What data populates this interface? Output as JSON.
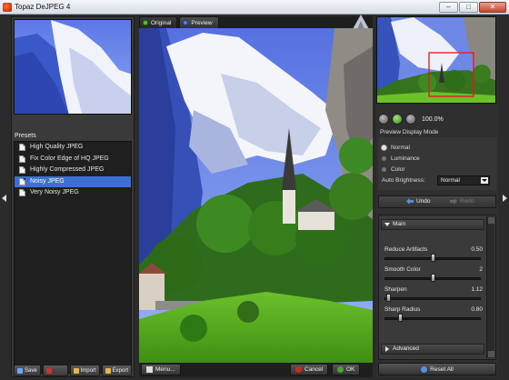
{
  "window": {
    "title": "Topaz DeJPEG 4",
    "controls": {
      "minimize": "–",
      "maximize": "□",
      "close": "✕"
    }
  },
  "presets": {
    "title": "Presets",
    "items": [
      {
        "label": "High Quality JPEG",
        "selected": false
      },
      {
        "label": "Fix Color Edge of HQ JPEG",
        "selected": false
      },
      {
        "label": "Highly Compressed JPEG",
        "selected": false
      },
      {
        "label": "Noisy JPEG",
        "selected": true
      },
      {
        "label": "Very Noisy JPEG",
        "selected": false
      }
    ]
  },
  "left_buttons": {
    "save": "Save",
    "delete": "",
    "import": "Import",
    "export": "Export"
  },
  "view_tabs": {
    "original": "Original",
    "preview": "Preview"
  },
  "center_buttons": {
    "menu": "Menu...",
    "cancel": "Cancel",
    "ok": "OK"
  },
  "zoom": {
    "level": "100.0%"
  },
  "preview_display": {
    "title": "Preview Display Mode",
    "modes": [
      {
        "label": "Normal",
        "selected": true
      },
      {
        "label": "Luminance",
        "selected": false
      },
      {
        "label": "Color",
        "selected": false
      }
    ],
    "auto_brightness_label": "Auto Brightness:",
    "auto_brightness_value": "Normal"
  },
  "history": {
    "undo": "Undo",
    "redo": "Redo"
  },
  "main_section": {
    "title": "Main",
    "sliders": [
      {
        "label": "Reduce Artifacts",
        "value": "0.50",
        "fraction": 0.5
      },
      {
        "label": "Smooth Color",
        "value": "2",
        "fraction": 0.5
      },
      {
        "label": "Sharpen",
        "value": "1.12",
        "fraction": 0.02
      },
      {
        "label": "Sharp Radius",
        "value": "0.80",
        "fraction": 0.15
      }
    ]
  },
  "advanced_section": {
    "title": "Advanced"
  },
  "reset": {
    "label": "Reset All"
  },
  "colors": {
    "accent_select": "#3c6fd4",
    "ok_green": "#4aa82e",
    "cancel_red": "#cc2b1d"
  }
}
